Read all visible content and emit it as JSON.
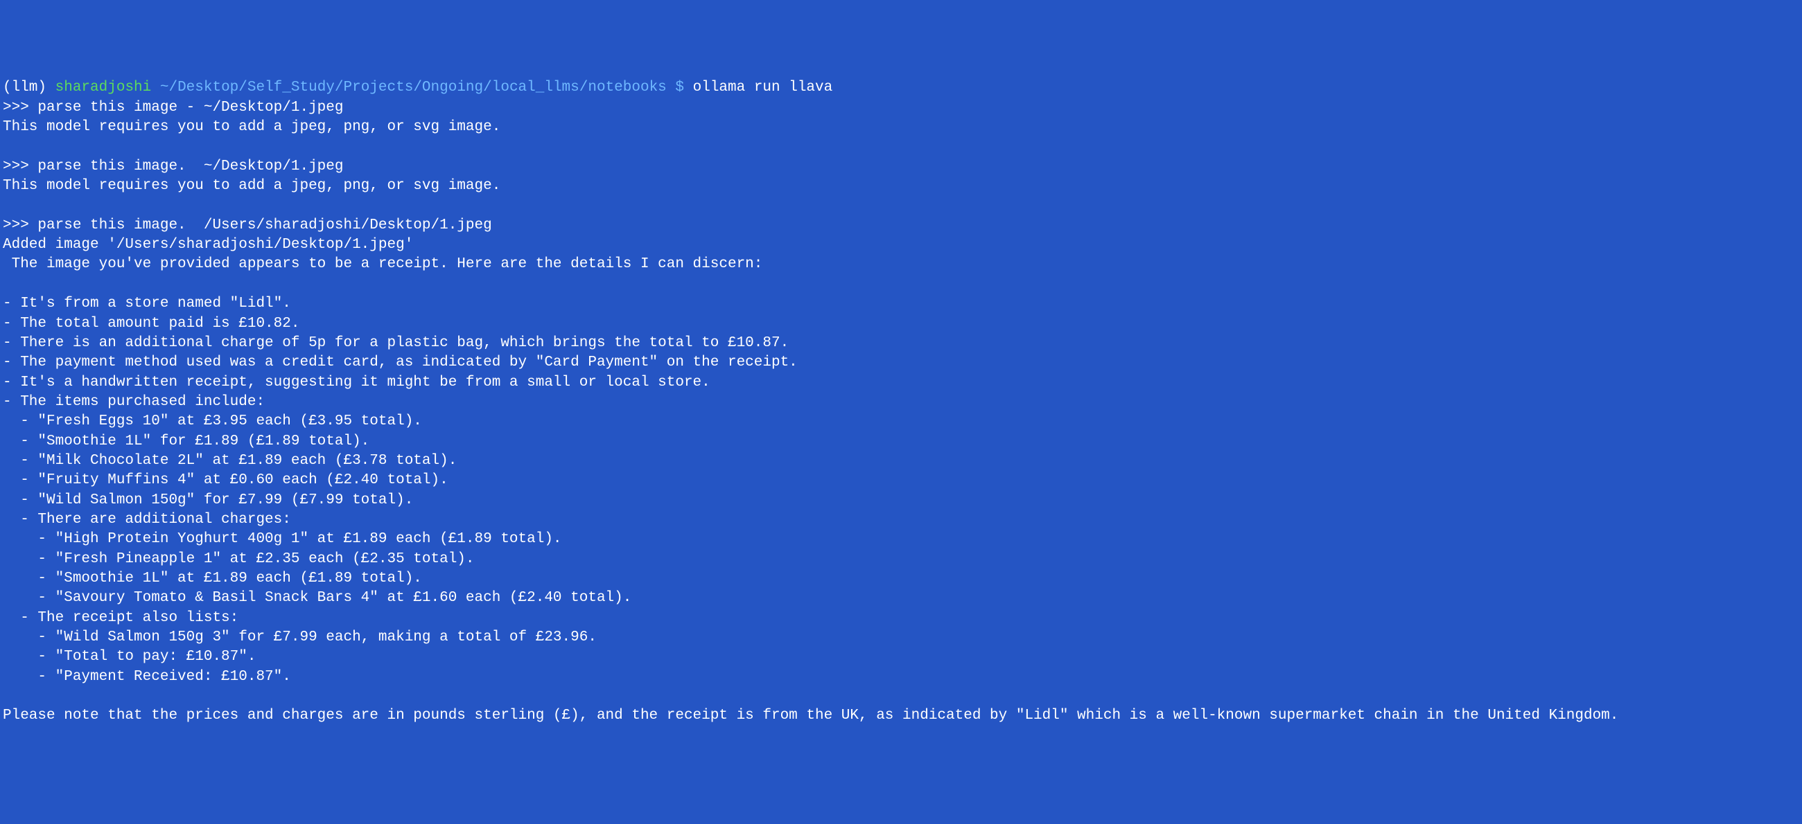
{
  "prompt": {
    "env": "(llm) ",
    "user": "sharadjoshi ",
    "path": "~/Desktop/Self_Study/Projects/Ongoing/local_llms/notebooks ",
    "dollar": "$ ",
    "command": "ollama run llava"
  },
  "lines": {
    "l01": ">>> parse this image - ~/Desktop/1.jpeg",
    "l02": "This model requires you to add a jpeg, png, or svg image.",
    "l03": "",
    "l04": ">>> parse this image.  ~/Desktop/1.jpeg",
    "l05": "This model requires you to add a jpeg, png, or svg image.",
    "l06": "",
    "l07": ">>> parse this image.  /Users/sharadjoshi/Desktop/1.jpeg",
    "l08": "Added image '/Users/sharadjoshi/Desktop/1.jpeg'",
    "l09": " The image you've provided appears to be a receipt. Here are the details I can discern:",
    "l10": "",
    "l11": "- It's from a store named \"Lidl\".",
    "l12": "- The total amount paid is £10.82.",
    "l13": "- There is an additional charge of 5p for a plastic bag, which brings the total to £10.87.",
    "l14": "- The payment method used was a credit card, as indicated by \"Card Payment\" on the receipt.",
    "l15": "- It's a handwritten receipt, suggesting it might be from a small or local store.",
    "l16": "- The items purchased include:",
    "l17": "  - \"Fresh Eggs 10\" at £3.95 each (£3.95 total).",
    "l18": "  - \"Smoothie 1L\" for £1.89 (£1.89 total).",
    "l19": "  - \"Milk Chocolate 2L\" at £1.89 each (£3.78 total).",
    "l20": "  - \"Fruity Muffins 4\" at £0.60 each (£2.40 total).",
    "l21": "  - \"Wild Salmon 150g\" for £7.99 (£7.99 total).",
    "l22": "  - There are additional charges:",
    "l23": "    - \"High Protein Yoghurt 400g 1\" at £1.89 each (£1.89 total).",
    "l24": "    - \"Fresh Pineapple 1\" at £2.35 each (£2.35 total).",
    "l25": "    - \"Smoothie 1L\" at £1.89 each (£1.89 total).",
    "l26": "    - \"Savoury Tomato & Basil Snack Bars 4\" at £1.60 each (£2.40 total).",
    "l27": "  - The receipt also lists:",
    "l28": "    - \"Wild Salmon 150g 3\" for £7.99 each, making a total of £23.96.",
    "l29": "    - \"Total to pay: £10.87\".",
    "l30": "    - \"Payment Received: £10.87\".",
    "l31": "",
    "l32": "Please note that the prices and charges are in pounds sterling (£), and the receipt is from the UK, as indicated by \"Lidl\" which is a well-known supermarket chain in the United Kingdom."
  }
}
